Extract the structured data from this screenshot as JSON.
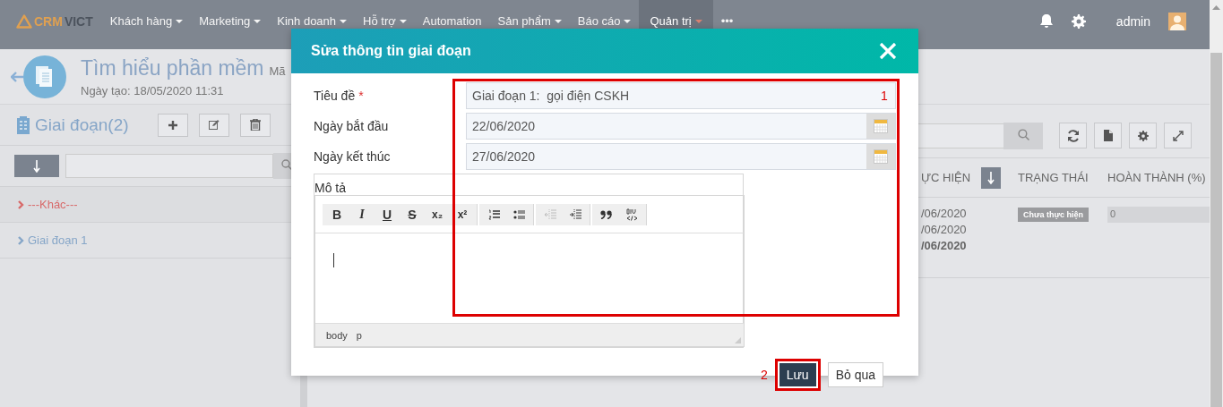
{
  "navbar": {
    "logo": {
      "primary": "CRM",
      "secondary": "VICT"
    },
    "menu": [
      {
        "label": "Khách hàng",
        "dropdown": true,
        "selected": false
      },
      {
        "label": "Marketing",
        "dropdown": true,
        "selected": false
      },
      {
        "label": "Kinh doanh",
        "dropdown": true,
        "selected": false
      },
      {
        "label": "Hỗ trợ",
        "dropdown": true,
        "selected": false
      },
      {
        "label": "Automation",
        "dropdown": false,
        "selected": false
      },
      {
        "label": "Sản phẩm",
        "dropdown": true,
        "selected": false
      },
      {
        "label": "Báo cáo",
        "dropdown": true,
        "selected": false
      },
      {
        "label": "Quản trị",
        "dropdown": true,
        "selected": true
      },
      {
        "label": "•••",
        "dropdown": false,
        "selected": false
      }
    ],
    "user": "admin"
  },
  "page": {
    "title": "Tìm hiểu phần mềm",
    "code_label": "Mã",
    "created": "Ngày tạo: 18/05/2020 11:31"
  },
  "stages_panel": {
    "title": "Giai đoạn(2)",
    "items": [
      {
        "label": "---Khác---",
        "selected": true
      },
      {
        "label": "Giai đoạn 1",
        "selected": false
      }
    ]
  },
  "table": {
    "columns": [
      "ỰC HIỆN",
      "TRẠNG THÁI",
      "HOÀN THÀNH (%)"
    ],
    "rows": [
      {
        "dates": [
          {
            "text": "/06/2020",
            "bold": false
          },
          {
            "text": "/06/2020",
            "bold": false
          },
          {
            "text": "/06/2020",
            "bold": true
          }
        ],
        "status": "Chưa thực hiện",
        "progress": "0",
        "level": 0
      }
    ]
  },
  "modal": {
    "title": "Sửa thông tin giai đoạn",
    "fields": [
      {
        "kind": "text",
        "label": "Tiêu đề",
        "required_mark": "*",
        "value": "Giai đoạn 1:  gọi điện CSKH"
      },
      {
        "kind": "date",
        "label": "Ngày bắt đầu",
        "value": "22/06/2020"
      },
      {
        "kind": "date",
        "label": "Ngày kết thúc",
        "value": "27/06/2020"
      },
      {
        "kind": "editor",
        "label": "Mô tả",
        "path": [
          "body",
          "p"
        ]
      }
    ],
    "toolbar": [
      [
        {
          "kind": "bold",
          "glyph": "B",
          "disabled": false
        },
        {
          "kind": "italic",
          "glyph": "I",
          "disabled": false
        },
        {
          "kind": "underline",
          "glyph": "U",
          "disabled": false
        },
        {
          "kind": "strike",
          "glyph": "S",
          "disabled": false
        },
        {
          "kind": "sub",
          "glyph": "x₂",
          "disabled": false
        },
        {
          "kind": "sup",
          "glyph": "x²",
          "disabled": false
        }
      ],
      [
        {
          "kind": "ol",
          "disabled": false
        },
        {
          "kind": "ul",
          "disabled": false
        }
      ],
      [
        {
          "kind": "outdent",
          "disabled": true
        },
        {
          "kind": "indent",
          "disabled": false
        }
      ],
      [
        {
          "kind": "quote",
          "disabled": false
        },
        {
          "kind": "source",
          "disabled": false
        }
      ]
    ],
    "annotations": [
      "1",
      "2"
    ],
    "buttons": [
      {
        "label": "Lưu",
        "kind": "primary",
        "highlighted": true
      },
      {
        "label": "Bỏ qua",
        "kind": "secondary",
        "highlighted": false
      }
    ]
  }
}
